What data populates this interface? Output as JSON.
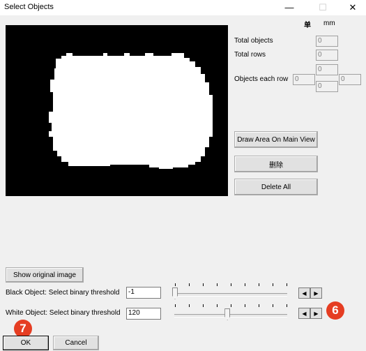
{
  "window": {
    "title": "Select Objects",
    "minimize_icon": "—",
    "maximize_icon": "☐",
    "close_icon": "✕"
  },
  "units": {
    "unit1": "单",
    "unit2": "mm"
  },
  "stats": {
    "total_objects_label": "Total objects",
    "total_objects_value": "0",
    "total_rows_label": "Total rows",
    "total_rows_value": "0",
    "objects_each_row_label": "Objects each row",
    "oer_top": "0",
    "oer_left": "0",
    "oer_center": "0",
    "oer_right": "0"
  },
  "buttons": {
    "draw_area": "Draw Area On Main View",
    "delete": "删除",
    "delete_all": "Delete All",
    "show_original": "Show original image",
    "ok": "OK",
    "cancel": "Cancel"
  },
  "thresholds": {
    "black_label": "Black Object: Select binary threshold",
    "black_value": "-1",
    "black_level_fraction": 0.0,
    "white_label": "White Object: Select binary threshold",
    "white_value": "120",
    "white_level_fraction": 0.47
  },
  "badges": {
    "six": "6",
    "seven": "7"
  }
}
